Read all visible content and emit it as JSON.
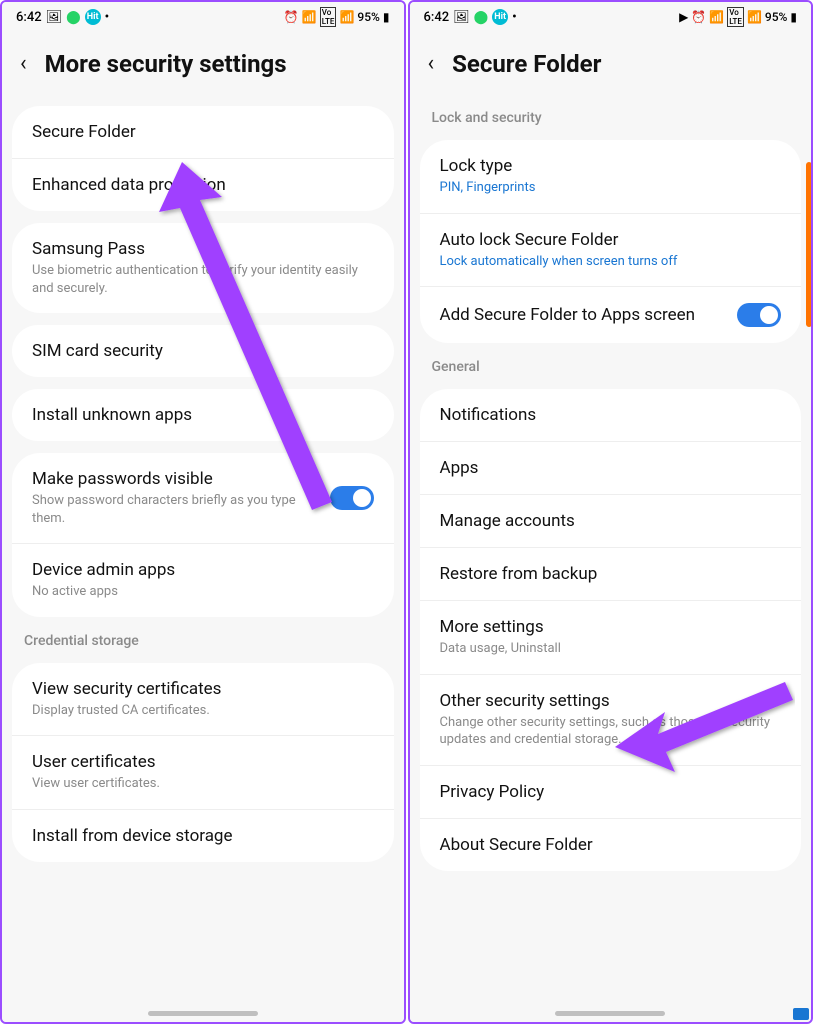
{
  "left": {
    "status": {
      "time": "6:42",
      "battery": "95%"
    },
    "header": "More security settings",
    "groups": [
      {
        "items": [
          {
            "title": "Secure Folder",
            "sub": ""
          },
          {
            "title": "Enhanced data protection",
            "sub": ""
          }
        ]
      },
      {
        "items": [
          {
            "title": "Samsung Pass",
            "sub": "Use biometric authentication to verify your identity easily and securely."
          }
        ]
      },
      {
        "items": [
          {
            "title": "SIM card security",
            "sub": ""
          }
        ]
      },
      {
        "items": [
          {
            "title": "Install unknown apps",
            "sub": ""
          }
        ]
      },
      {
        "items": [
          {
            "title": "Make passwords visible",
            "sub": "Show password characters briefly as you type them.",
            "toggle": true
          },
          {
            "title": "Device admin apps",
            "sub": "No active apps"
          }
        ]
      }
    ],
    "section_credential": "Credential storage",
    "credential_group": [
      {
        "title": "View security certificates",
        "sub": "Display trusted CA certificates."
      },
      {
        "title": "User certificates",
        "sub": "View user certificates."
      },
      {
        "title": "Install from device storage",
        "sub": ""
      }
    ]
  },
  "right": {
    "status": {
      "time": "6:42",
      "battery": "95%"
    },
    "header": "Secure Folder",
    "section_lock": "Lock and security",
    "lock_group": [
      {
        "title": "Lock type",
        "sub": "PIN, Fingerprints",
        "blue": true
      },
      {
        "title": "Auto lock Secure Folder",
        "sub": "Lock automatically when screen turns off",
        "blue": true
      },
      {
        "title": "Add Secure Folder to Apps screen",
        "sub": "",
        "toggle": true
      }
    ],
    "section_general": "General",
    "general_group": [
      {
        "title": "Notifications",
        "sub": ""
      },
      {
        "title": "Apps",
        "sub": ""
      },
      {
        "title": "Manage accounts",
        "sub": ""
      },
      {
        "title": "Restore from backup",
        "sub": ""
      },
      {
        "title": "More settings",
        "sub": "Data usage, Uninstall"
      },
      {
        "title": "Other security settings",
        "sub": "Change other security settings, such as those for security updates and credential storage."
      },
      {
        "title": "Privacy Policy",
        "sub": ""
      },
      {
        "title": "About Secure Folder",
        "sub": ""
      }
    ]
  }
}
